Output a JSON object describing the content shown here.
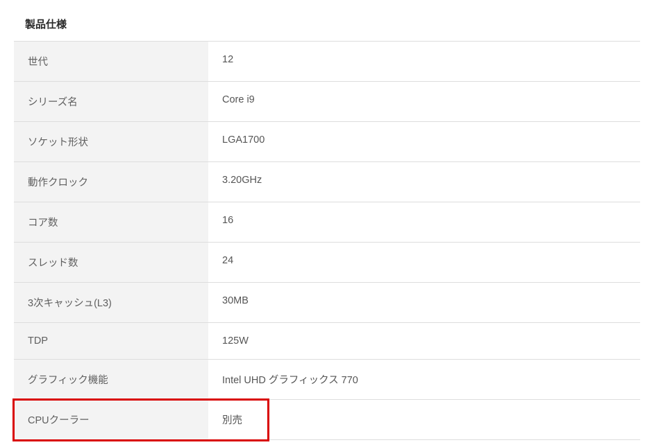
{
  "title": "製品仕様",
  "rows": [
    {
      "label": "世代",
      "value": "12"
    },
    {
      "label": "シリーズ名",
      "value": "Core i9"
    },
    {
      "label": "ソケット形状",
      "value": "LGA1700"
    },
    {
      "label": "動作クロック",
      "value": "3.20GHz"
    },
    {
      "label": "コア数",
      "value": "16"
    },
    {
      "label": "スレッド数",
      "value": "24"
    },
    {
      "label": "3次キャッシュ(L3)",
      "value": "30MB"
    },
    {
      "label": "TDP",
      "value": "125W"
    },
    {
      "label": "グラフィック機能",
      "value": "Intel UHD グラフィックス 770"
    },
    {
      "label": "CPUクーラー",
      "value": "別売"
    }
  ],
  "highlight_row_index": 9
}
